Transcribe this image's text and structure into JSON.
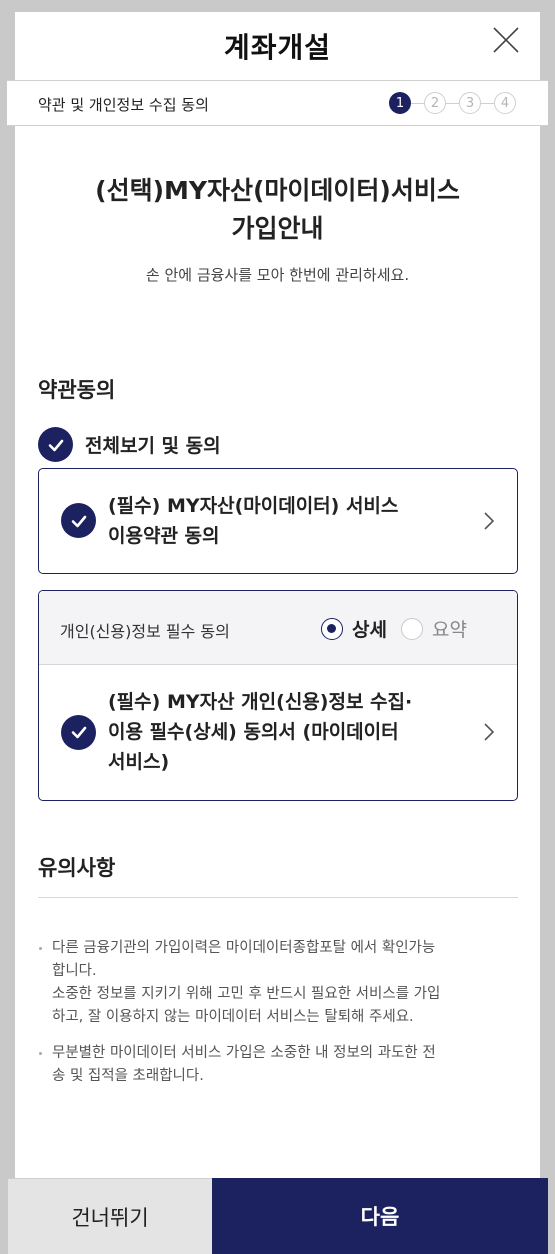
{
  "header": {
    "title": "계좌개설",
    "close_icon": "close-icon"
  },
  "progress": {
    "label": "약관 및 개인정보 수집 동의",
    "steps": [
      "1",
      "2",
      "3",
      "4"
    ],
    "current_step": 1
  },
  "hero": {
    "title_line1": "(선택)MY자산(마이데이터)서비스",
    "title_line2": "가입안내",
    "subtitle": "손 안에 금융사를 모아 한번에 관리하세요."
  },
  "agreement": {
    "section_title": "약관동의",
    "all_agree_label": "전체보기 및 동의",
    "item1": {
      "line1": "(필수) MY자산(마이데이터) 서비스",
      "line2": "이용약관 동의",
      "checked": true
    },
    "item2": {
      "header_label": "개인(신용)정보 필수 동의",
      "option_detail": "상세",
      "option_summary": "요약",
      "selected_option": "상세",
      "line1": "(필수) MY자산 개인(신용)정보 수집·",
      "line2": "이용 필수(상세) 동의서 (마이데이터",
      "line3": "서비스)",
      "checked": true
    }
  },
  "notice": {
    "section_title": "유의사항",
    "note1_line1": "다른 금융기관의 가입이력은 마이데이터종합포탈 에서 확인가능",
    "note1_line2": "합니다.",
    "note1_line3": "소중한 정보를 지키기 위해 고민 후 반드시 필요한 서비스를 가입",
    "note1_line4": "하고, 잘 이용하지 않는 마이데이터 서비스는 탈퇴해 주세요.",
    "note2_line1": "무분별한 마이데이터 서비스 가입은 소중한 내 정보의 과도한 전",
    "note2_line2": "송 및 집적을 초래합니다."
  },
  "footer": {
    "skip_label": "건너뛰기",
    "next_label": "다음"
  },
  "colors": {
    "brand_navy": "#1c2260",
    "background_gray": "#c9c9c9",
    "skip_button_bg": "#e4e4e4"
  }
}
